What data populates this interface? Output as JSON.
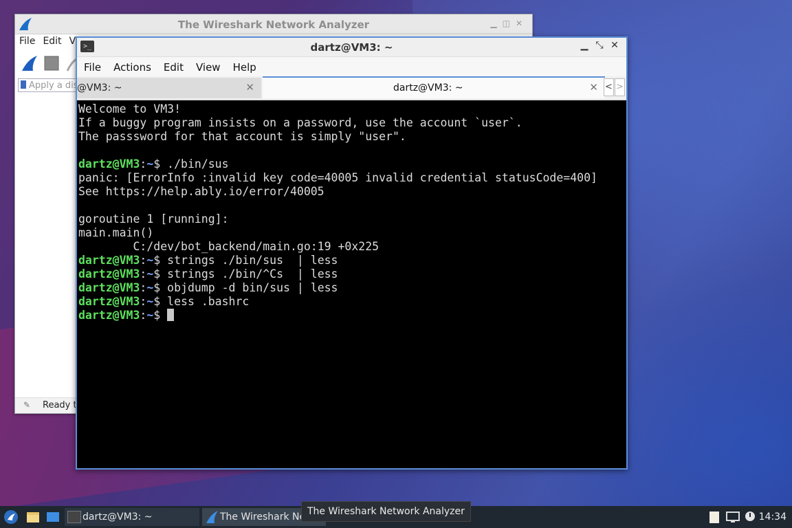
{
  "wireshark": {
    "title": "The Wireshark Network Analyzer",
    "menu": [
      "File",
      "Edit",
      "V"
    ],
    "filter_placeholder": "Apply a dis",
    "status": "Ready to"
  },
  "terminal": {
    "title": "dartz@VM3: ~",
    "menu": [
      "File",
      "Actions",
      "Edit",
      "View",
      "Help"
    ],
    "tabs": [
      {
        "label": "@VM3: ~"
      },
      {
        "label": "dartz@VM3: ~"
      }
    ],
    "lines": [
      {
        "text": "Welcome to VM3!"
      },
      {
        "text": "If a buggy program insists on a password, use the account `user`."
      },
      {
        "text": "The passsword for that account is simply \"user\"."
      },
      {
        "text": ""
      },
      {
        "user": "dartz@VM3",
        "path": "~",
        "cmd": "$ ./bin/sus"
      },
      {
        "text": "panic: [ErrorInfo :invalid key code=40005 invalid credential statusCode=400]"
      },
      {
        "text": "See https://help.ably.io/error/40005"
      },
      {
        "text": ""
      },
      {
        "text": "goroutine 1 [running]:"
      },
      {
        "text": "main.main()"
      },
      {
        "text": "        C:/dev/bot_backend/main.go:19 +0x225"
      },
      {
        "user": "dartz@VM3",
        "path": "~",
        "cmd": "$ strings ./bin/sus  | less"
      },
      {
        "user": "dartz@VM3",
        "path": "~",
        "cmd": "$ strings ./bin/^Cs  | less"
      },
      {
        "user": "dartz@VM3",
        "path": "~",
        "cmd": "$ objdump -d bin/sus | less"
      },
      {
        "user": "dartz@VM3",
        "path": "~",
        "cmd": "$ less .bashrc"
      },
      {
        "user": "dartz@VM3",
        "path": "~",
        "cmd": "$ ",
        "cursor": true
      }
    ]
  },
  "taskbar": {
    "tasks": [
      "dartz@VM3: ~",
      "The Wireshark Ne"
    ],
    "tooltip": "The Wireshark Network Analyzer",
    "clock": "14:34"
  },
  "colors": {
    "prompt": "#5ee05e",
    "path": "#7aa6ff",
    "accent": "#5b8ed8"
  }
}
